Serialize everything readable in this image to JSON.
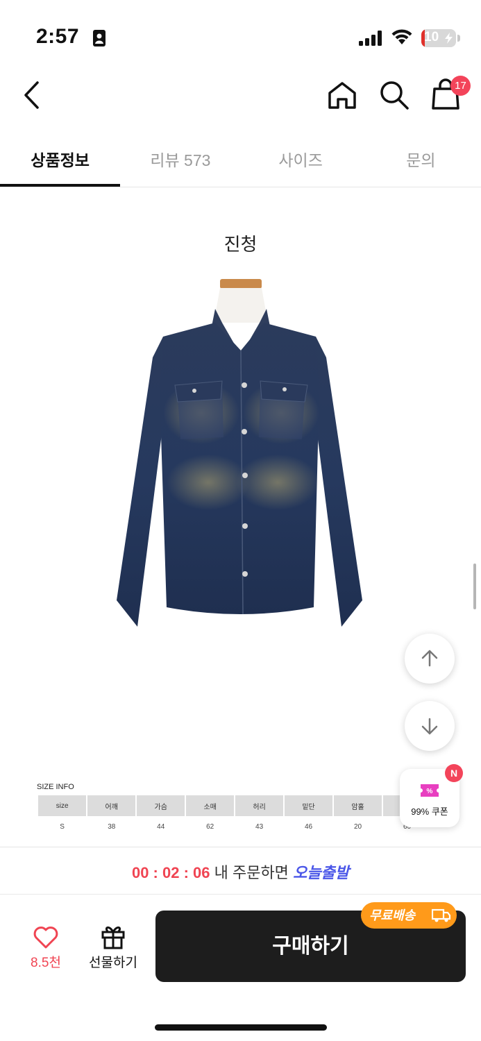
{
  "status_bar": {
    "time": "2:57",
    "battery": "10",
    "battery_level": 0.1
  },
  "header": {
    "cart_count": "17"
  },
  "tabs": [
    {
      "label": "상품정보",
      "active": true
    },
    {
      "label": "리뷰 573",
      "active": false
    },
    {
      "label": "사이즈",
      "active": false
    },
    {
      "label": "문의",
      "active": false
    }
  ],
  "product": {
    "color_name": "진청"
  },
  "size_info": {
    "title": "SIZE INFO",
    "headers": [
      "size",
      "어깨",
      "가슴",
      "소매",
      "허리",
      "밑단",
      "암홀",
      ""
    ],
    "rows": [
      [
        "S",
        "38",
        "44",
        "62",
        "43",
        "46",
        "20",
        "60"
      ]
    ]
  },
  "coupon": {
    "badge": "N",
    "label": "99% 쿠폰"
  },
  "order_banner": {
    "timer": "00 : 02 : 06",
    "text": "내 주문하면",
    "highlight": "오늘출발"
  },
  "actions": {
    "like_count": "8.5천",
    "gift_label": "선물하기",
    "buy_label": "구매하기",
    "free_shipping": "무료배송"
  },
  "colors": {
    "accent_red": "#f04452",
    "badge_red": "#f3445a",
    "highlight_blue": "#4a56e8",
    "free_ship_orange": "#ff9a1a",
    "buy_button": "#1d1d1d"
  }
}
